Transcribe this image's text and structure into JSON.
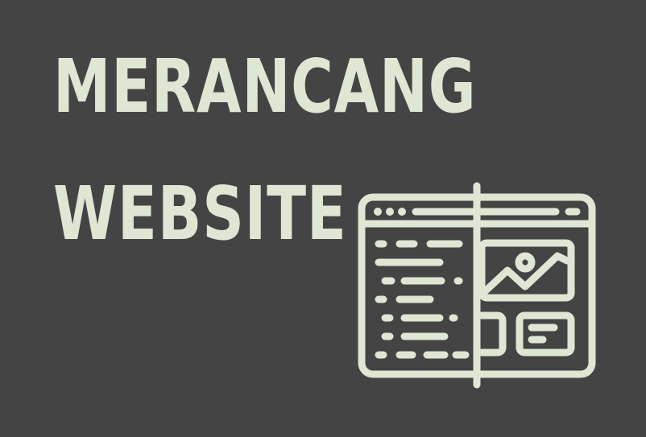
{
  "title": {
    "line1": "MERANCANG",
    "line2": "WEBSITE"
  },
  "colors": {
    "background": "#434443",
    "foreground": "#dfe6d3"
  },
  "illustration": {
    "icon": "website-design-icon"
  }
}
